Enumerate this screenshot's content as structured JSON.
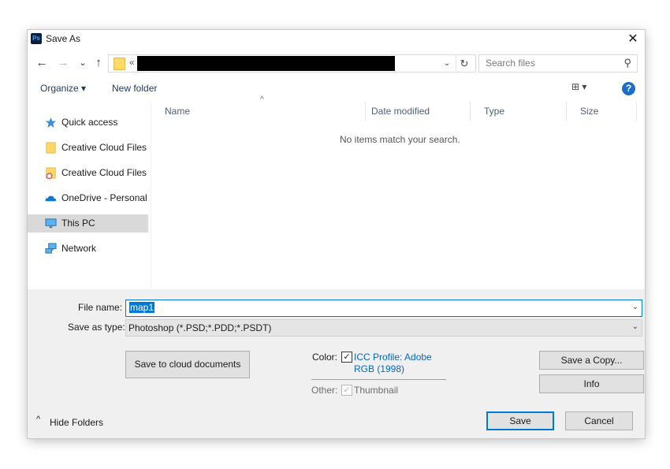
{
  "window": {
    "title": "Save As",
    "app_icon": "Ps",
    "close": "✕"
  },
  "nav": {
    "back": "←",
    "forward": "→",
    "recent": "⌄",
    "up": "↑",
    "address_prefix": "«",
    "address_dropdown": "⌄",
    "refresh": "↻",
    "search_placeholder": "Search files",
    "search_icon": "⚲"
  },
  "toolbar": {
    "organize": "Organize ▾",
    "new_folder": "New folder",
    "view": "⊞ ▾",
    "help": "?"
  },
  "sidebar": {
    "items": [
      {
        "label": "Quick access",
        "icon": "star-icon"
      },
      {
        "label": "Creative Cloud Files",
        "icon": "folder-icon"
      },
      {
        "label": "Creative Cloud Files P",
        "icon": "cloud-folder-icon"
      },
      {
        "label": "OneDrive - Personal",
        "icon": "onedrive-icon"
      },
      {
        "label": "This PC",
        "icon": "monitor-icon",
        "selected": true
      },
      {
        "label": "Network",
        "icon": "network-icon"
      }
    ]
  },
  "file_list": {
    "columns": [
      "Name",
      "Date modified",
      "Type",
      "Size"
    ],
    "sort_arrow": "^",
    "empty_message": "No items match your search."
  },
  "form": {
    "file_name_label": "File name:",
    "file_name_value": "map1",
    "save_as_type_label": "Save as type:",
    "save_as_type_value": "Photoshop (*.PSD;*.PDD;*.PSDT)",
    "save_to_cloud": "Save to cloud documents",
    "color_label": "Color:",
    "icc_line1": "ICC Profile:  Adobe",
    "icc_line2": "RGB (1998)",
    "other_label": "Other:",
    "thumbnail_label": "Thumbnail",
    "save_copy": "Save a Copy...",
    "info": "Info",
    "hide_folders": "Hide Folders",
    "save": "Save",
    "cancel": "Cancel",
    "check": "✓",
    "dropdown_arrow": "⌄",
    "caret_up": "^"
  }
}
